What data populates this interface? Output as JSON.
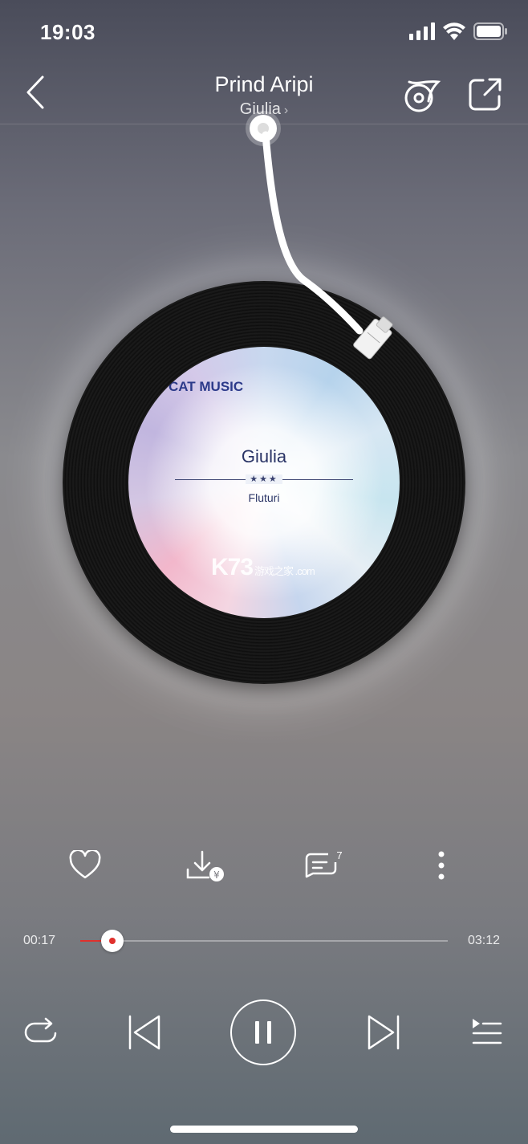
{
  "status_bar": {
    "time": "19:03"
  },
  "header": {
    "title": "Prind Aripi",
    "artist": "Giulia",
    "artist_chevron": "›"
  },
  "disc_label": {
    "brand": "CAT MUSIC",
    "artist": "Giulia",
    "stars": "★★★",
    "album": "Fluturi",
    "watermark": "K73",
    "watermark_small": "游戏之家 .com"
  },
  "actions": {
    "like_icon": "heart-icon",
    "download_icon": "download-paid-icon",
    "comment_icon": "comment-icon",
    "comment_count": "7",
    "more_icon": "more-vertical-icon"
  },
  "progress": {
    "current": "00:17",
    "total": "03:12",
    "fraction": 0.088,
    "accent": "#e0312d"
  },
  "controls": {
    "repeat_icon": "repeat-icon",
    "prev_icon": "previous-icon",
    "play_state_icon": "pause-icon",
    "next_icon": "next-icon",
    "playlist_icon": "playlist-icon"
  }
}
